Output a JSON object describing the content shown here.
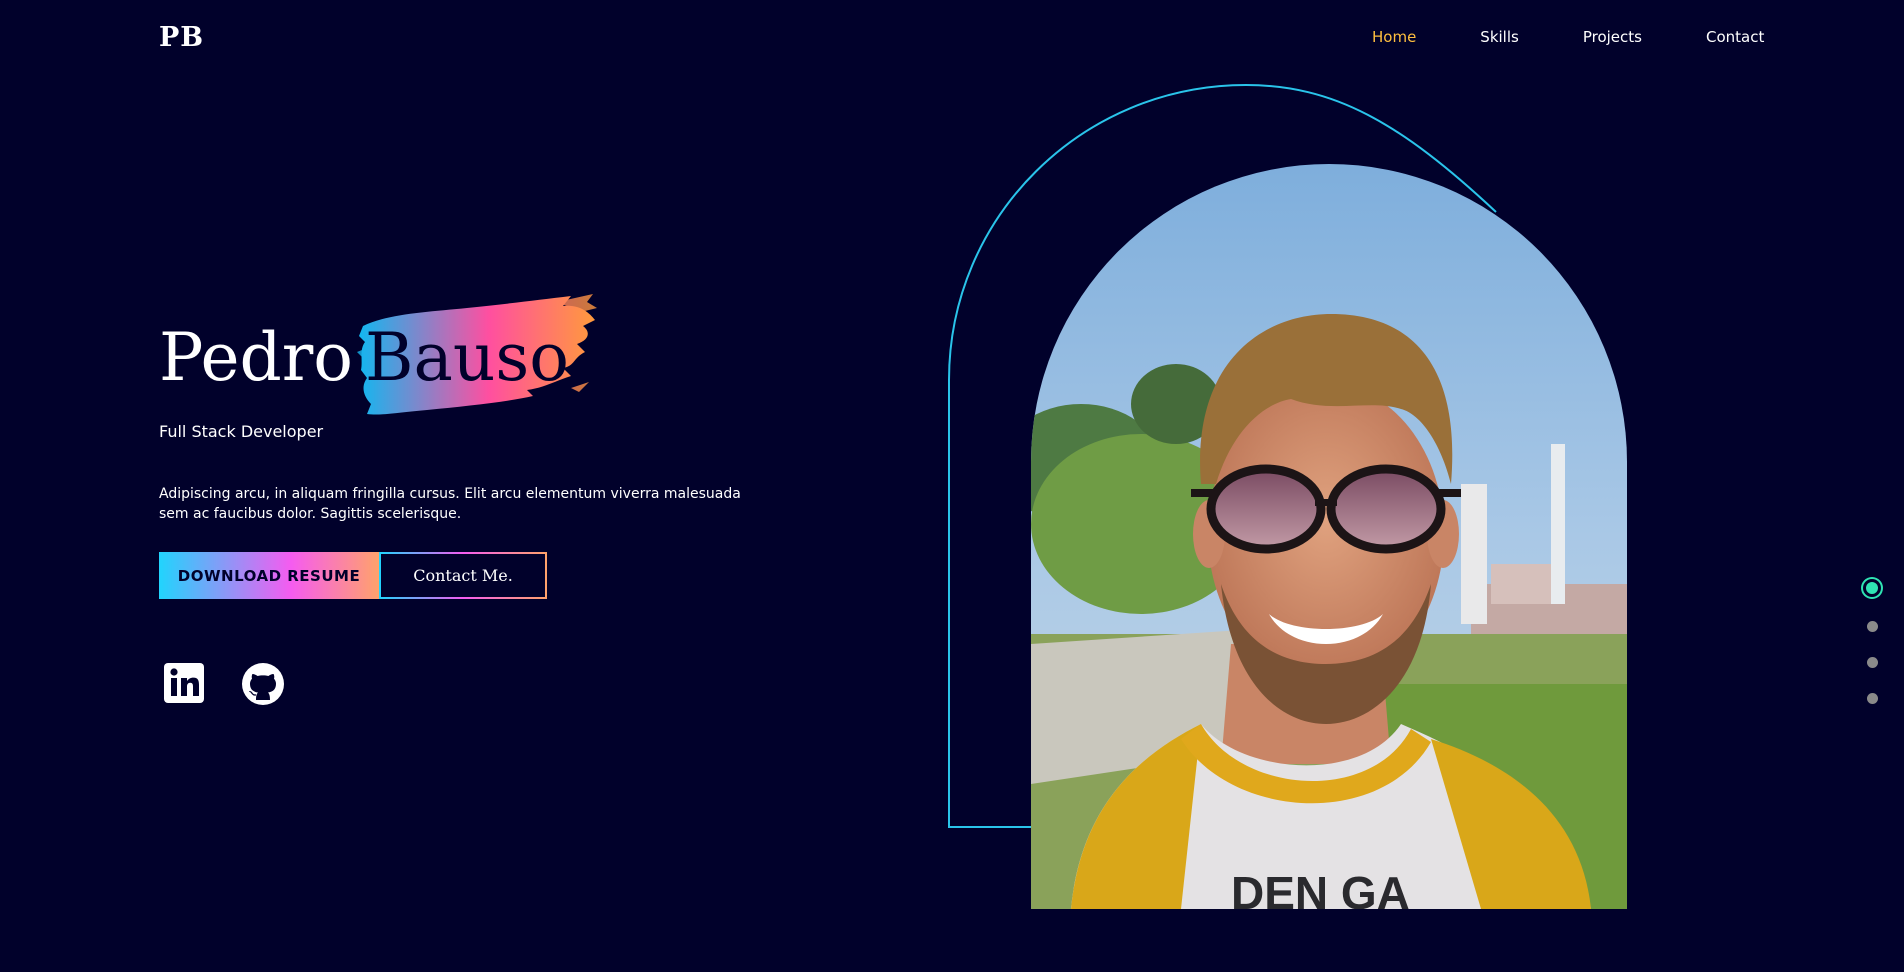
{
  "header": {
    "logo": "PB",
    "nav": [
      {
        "label": "Home",
        "active": true
      },
      {
        "label": "Skills",
        "active": false
      },
      {
        "label": "Projects",
        "active": false
      },
      {
        "label": "Contact",
        "active": false
      }
    ]
  },
  "hero": {
    "first_name": "Pedro",
    "last_name": "Bauso",
    "role": "Full Stack Developer",
    "description": "Adipiscing arcu, in aliquam fringilla cursus. Elit arcu elementum viverra malesuada sem ac faucibus dolor. Sagittis scelerisque.",
    "download_label": "DOWNLOAD RESUME",
    "contact_label": "Contact Me.",
    "shirt_text": "DEN GA"
  },
  "social": [
    {
      "icon": "linkedin-icon"
    },
    {
      "icon": "github-icon"
    }
  ],
  "section_dots": {
    "count": 4,
    "active_index": 0
  },
  "colors": {
    "background": "#01012b",
    "accent_nav": "#ffbf3f",
    "outline": "#2ac4ea",
    "dot_active": "#2fe3b3",
    "gradient": [
      "#21d4fd",
      "#f55cf0",
      "#ffa26b"
    ]
  }
}
